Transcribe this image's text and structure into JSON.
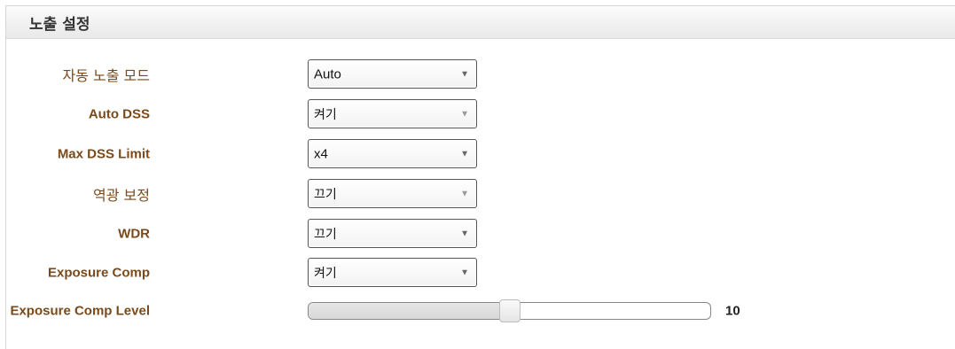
{
  "section": {
    "title": "노출 설정"
  },
  "settings": [
    {
      "label": "자동 노출 모드",
      "value": "Auto"
    },
    {
      "label": "Auto DSS",
      "value": "켜기"
    },
    {
      "label": "Max DSS Limit",
      "value": "x4"
    },
    {
      "label": "역광 보정",
      "value": "끄기"
    },
    {
      "label": "WDR",
      "value": "끄기"
    },
    {
      "label": "Exposure Comp",
      "value": "켜기"
    }
  ],
  "exposure_comp_level": {
    "label": "Exposure Comp Level",
    "value": "10",
    "fraction": 0.5
  },
  "icons": {
    "dropdown": "chevron-down-icon"
  },
  "colors": {
    "label": "#7a4a1a",
    "border": "#555555"
  }
}
